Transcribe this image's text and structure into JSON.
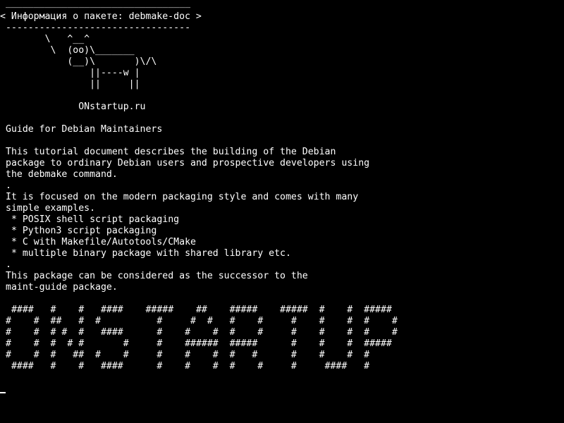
{
  "colors": {
    "background": "#000000",
    "foreground": "#ffffff"
  },
  "speech_bubble": {
    "top_border": "_________________________________",
    "title_line": "< Информация о пакете: debmake-doc >",
    "bottom_border": "---------------------------------"
  },
  "cow": [
    "       \\   ^__^",
    "        \\  (oo)\\_______",
    "           (__)\\       )\\/\\",
    "               ||----w |",
    "               ||     ||"
  ],
  "site_signature": "             ONstartup.ru",
  "description": {
    "summary": "Guide for Debian Maintainers",
    "paragraph1": [
      "This tutorial document describes the building of the Debian",
      "package to ordinary Debian users and prospective developers using",
      "the debmake command."
    ],
    "separator1": ".",
    "paragraph2": [
      "It is focused on the modern packaging style and comes with many",
      "simple examples."
    ],
    "bullets": [
      " * POSIX shell script packaging",
      " * Python3 script packaging",
      " * C with Makefile/Autotools/CMake",
      " * multiple binary package with shared library etc."
    ],
    "separator2": ".",
    "paragraph3": [
      "This package can be considered as the successor to the",
      "maint-guide package."
    ]
  },
  "banner": [
    " ####   #    #   ####    #####    ##    #####    #####  #    #  #####",
    "#    #  ##   #  #          #     #  #   #    #     #    #    #  #    #",
    "#    #  # #  #   ####      #    #    #  #    #     #    #    #  #    #",
    "#    #  #  # #       #     #    ######  #####      #    #    #  #####",
    "#    #  #   ##  #    #     #    #    #  #   #      #    #    #  #",
    " ####   #    #   ####      #    #    #  #    #     #     ####   #"
  ]
}
